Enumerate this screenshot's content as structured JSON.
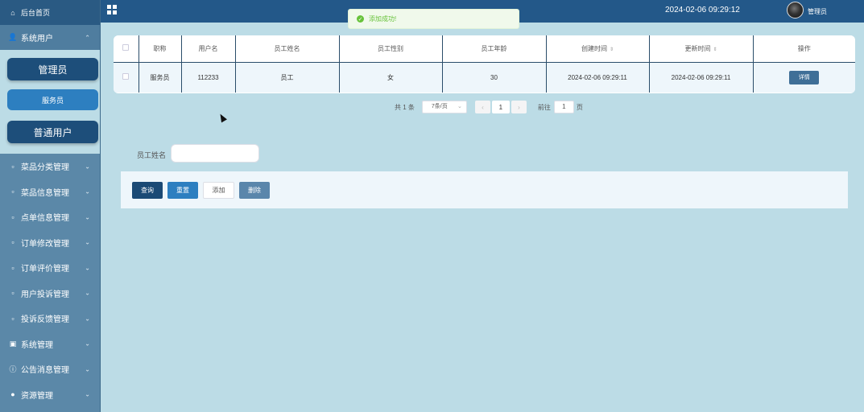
{
  "sidebar": {
    "home_label": "后台首页",
    "group_label": "系统用户",
    "sub_items": [
      "管理员",
      "服务员",
      "普通用户"
    ],
    "items": [
      {
        "label": "菜品分类管理",
        "icon": "doc-icon"
      },
      {
        "label": "菜品信息管理",
        "icon": "doc-icon"
      },
      {
        "label": "点单信息管理",
        "icon": "doc-icon"
      },
      {
        "label": "订单修改管理",
        "icon": "doc-icon"
      },
      {
        "label": "订单评价管理",
        "icon": "doc-icon"
      },
      {
        "label": "用户投诉管理",
        "icon": "doc-icon"
      },
      {
        "label": "投诉反馈管理",
        "icon": "doc-icon"
      },
      {
        "label": "系统管理",
        "icon": "image-icon"
      },
      {
        "label": "公告消息管理",
        "icon": "info-icon"
      },
      {
        "label": "资源管理",
        "icon": "shield-icon"
      }
    ]
  },
  "header": {
    "time": "2024-02-06 09:29:12",
    "user": "管理员"
  },
  "toast": {
    "message": "添加成功!"
  },
  "table": {
    "columns": [
      "职称",
      "用户名",
      "员工姓名",
      "员工性别",
      "员工年龄",
      "创建时间",
      "更新时间",
      "操作"
    ],
    "rows": [
      {
        "title": "服务员",
        "username": "112233",
        "name": "员工",
        "gender": "女",
        "age": "30",
        "created": "2024-02-06 09:29:11",
        "updated": "2024-02-06 09:29:11",
        "action": "详情"
      }
    ]
  },
  "pager": {
    "total": "共 1 条",
    "page_size": "7条/页",
    "current": "1",
    "goto_label": "前往",
    "goto_value": "1",
    "page_label": "页"
  },
  "search": {
    "label": "员工姓名",
    "value": ""
  },
  "actions": {
    "query": "查询",
    "reset": "重置",
    "add": "添加",
    "delete": "删除"
  }
}
